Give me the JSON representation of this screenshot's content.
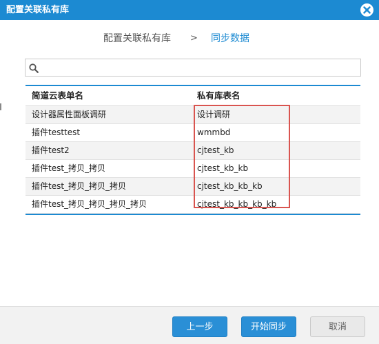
{
  "dialog": {
    "title": "配置关联私有库",
    "close_icon": "close-icon"
  },
  "steps": {
    "step1": "配置关联私有库",
    "separator": ">",
    "step2": "同步数据",
    "active_color": "#1c8ad2"
  },
  "search": {
    "icon": "search-icon",
    "value": "",
    "placeholder": ""
  },
  "table": {
    "headers": [
      "简道云表单名",
      "私有库表名"
    ],
    "rows": [
      [
        "设计器属性面板调研",
        "设计调研"
      ],
      [
        "插件testtest",
        "wmmbd"
      ],
      [
        "插件test2",
        "cjtest_kb"
      ],
      [
        "插件test_拷贝_拷贝",
        "cjtest_kb_kb"
      ],
      [
        "插件test_拷贝_拷贝_拷贝",
        "cjtest_kb_kb_kb"
      ],
      [
        "插件test_拷贝_拷贝_拷贝_拷贝",
        "cjtest_kb_kb_kb_kb"
      ]
    ]
  },
  "footer": {
    "prev_label": "上一步",
    "start_label": "开始同步",
    "cancel_label": "取消"
  },
  "colors": {
    "brand": "#1c8ad2",
    "highlight": "#d9544f"
  }
}
